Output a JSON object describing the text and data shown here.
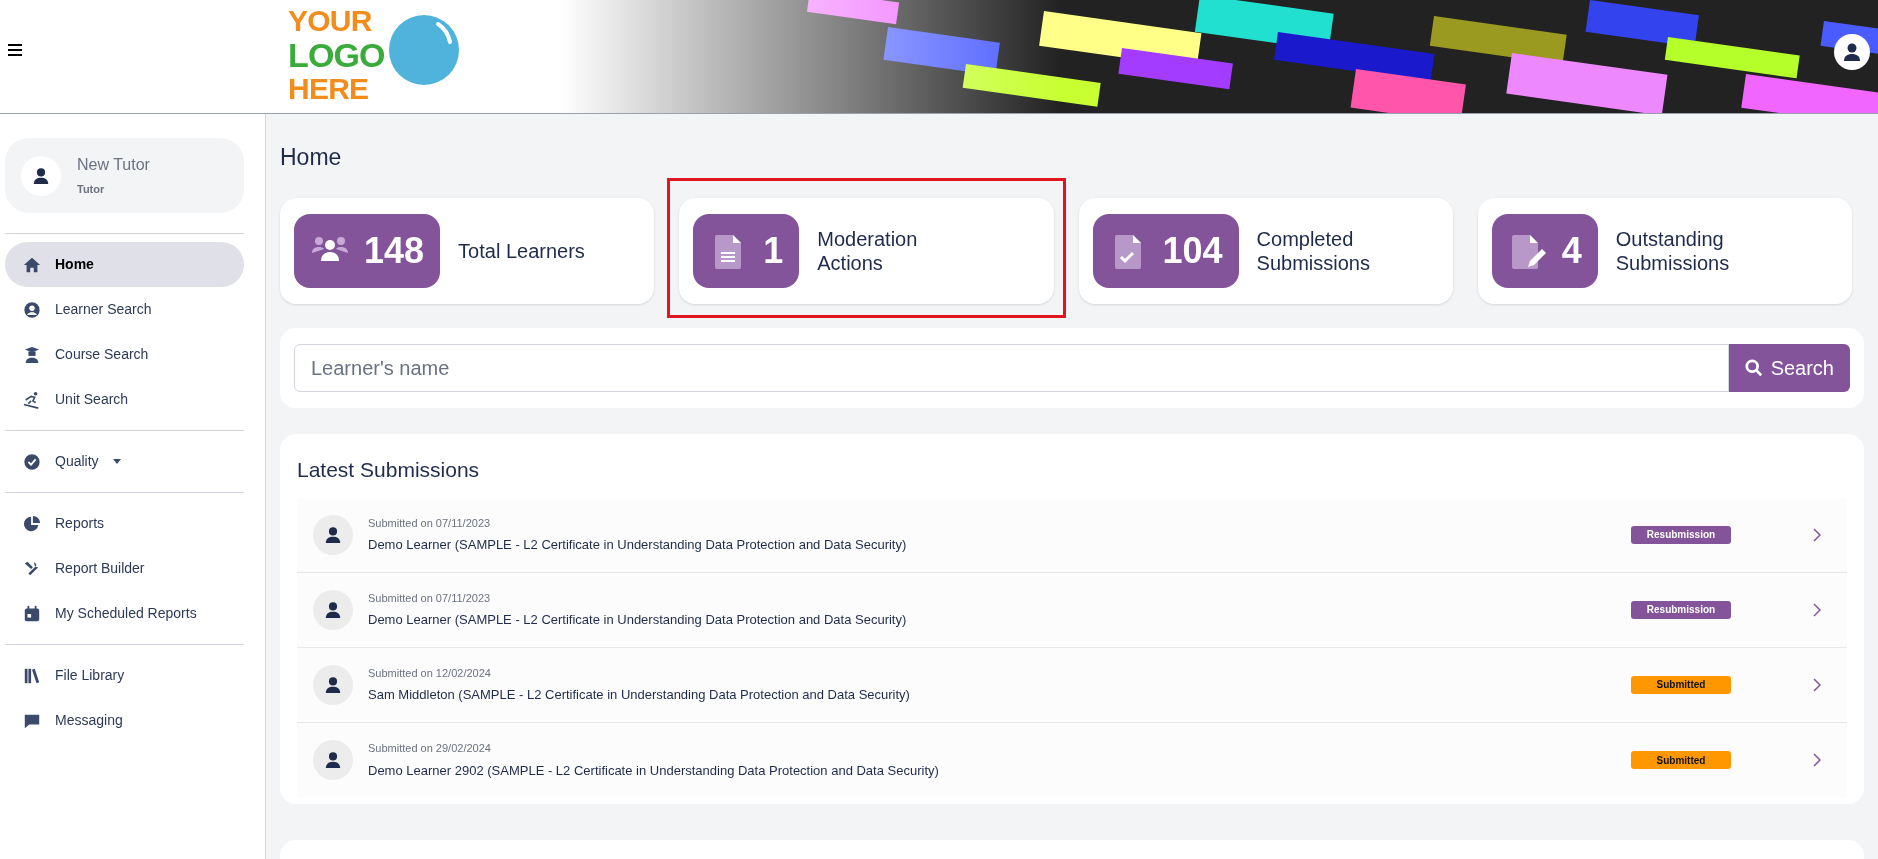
{
  "header": {
    "logo": {
      "lines": [
        "YOUR",
        "LOGO",
        "HERE"
      ]
    }
  },
  "sidebar": {
    "profile": {
      "name": "New Tutor",
      "role": "Tutor"
    },
    "groups": [
      {
        "items": [
          {
            "label": "Home",
            "selected": true,
            "kind": "link"
          },
          {
            "label": "Learner Search",
            "selected": false,
            "kind": "link"
          },
          {
            "label": "Course Search",
            "selected": false,
            "kind": "link"
          },
          {
            "label": "Unit Search",
            "selected": false,
            "kind": "link"
          }
        ]
      },
      {
        "items": [
          {
            "label": "Quality",
            "selected": false,
            "kind": "dropdown"
          }
        ]
      },
      {
        "items": [
          {
            "label": "Reports",
            "selected": false,
            "kind": "link"
          },
          {
            "label": "Report Builder",
            "selected": false,
            "kind": "link"
          },
          {
            "label": "My Scheduled Reports",
            "selected": false,
            "kind": "link"
          }
        ]
      },
      {
        "items": [
          {
            "label": "File Library",
            "selected": false,
            "kind": "link"
          },
          {
            "label": "Messaging",
            "selected": false,
            "kind": "link"
          }
        ]
      }
    ]
  },
  "page_title": "Home",
  "stats": [
    {
      "value": "148",
      "label": "Total Learners",
      "highlighted": false
    },
    {
      "value": "1",
      "label": "Moderation Actions",
      "highlighted": true
    },
    {
      "value": "104",
      "label": "Completed Submissions",
      "highlighted": false
    },
    {
      "value": "4",
      "label": "Outstanding Submissions",
      "highlighted": false
    }
  ],
  "search": {
    "placeholder": "Learner's name",
    "button": "Search"
  },
  "latest_submissions": {
    "title": "Latest Submissions",
    "rows": [
      {
        "date": "Submitted on 07/11/2023",
        "text": "Demo Learner (SAMPLE - L2 Certificate in Understanding Data Protection and Data Security)",
        "status": "Resubmission",
        "color": "#84549b"
      },
      {
        "date": "Submitted on 07/11/2023",
        "text": "Demo Learner (SAMPLE - L2 Certificate in Understanding Data Protection and Data Security)",
        "status": "Resubmission",
        "color": "#84549b"
      },
      {
        "date": "Submitted on 12/02/2024",
        "text": "Sam Middleton (SAMPLE - L2 Certificate in Understanding Data Protection and Data Security)",
        "status": "Submitted",
        "color": "#ff9800"
      },
      {
        "date": "Submitted on 29/02/2024",
        "text": "Demo Learner 2902 (SAMPLE - L2 Certificate in Understanding Data Protection and Data Security)",
        "status": "Submitted",
        "color": "#ff9800"
      }
    ]
  }
}
